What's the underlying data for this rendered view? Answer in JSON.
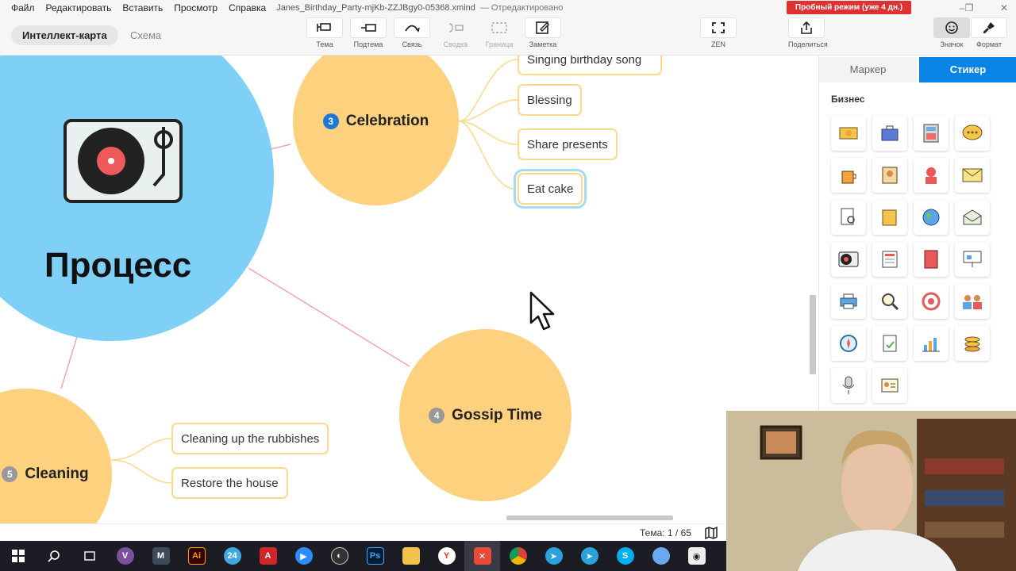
{
  "menu": {
    "items": [
      "Файл",
      "Редактировать",
      "Вставить",
      "Просмотр",
      "Справка"
    ],
    "document_title": "Janes_Birthday_Party-mjKb-ZZJBgy0-05368.xmind",
    "document_status": "— Отредактировано",
    "trial_badge": "Пробный режим (уже 4 дн.)"
  },
  "toolbar": {
    "view_tabs": [
      "Интеллект-карта",
      "Схема"
    ],
    "tools": {
      "topic": "Тема",
      "subtopic": "Подтема",
      "relationship": "Связь",
      "summary": "Сводка",
      "boundary": "Граница",
      "note": "Заметка",
      "zen": "ZEN",
      "share": "Поделиться",
      "icon": "Значок",
      "format": "Формат"
    }
  },
  "canvas": {
    "central_topic": "Процесс",
    "topics": [
      {
        "number": "3",
        "title": "Celebration",
        "color": "#fdd17d"
      },
      {
        "number": "4",
        "title": "Gossip Time",
        "color": "#fdd17d"
      },
      {
        "number": "5",
        "title": "Cleaning",
        "color": "#fdd17d"
      }
    ],
    "subtopics": {
      "celebration": [
        "Singing birthday song",
        "Blessing",
        "Share presents",
        "Eat cake"
      ],
      "cleaning": [
        "Cleaning up the rubbishes",
        "Restore  the house"
      ]
    },
    "central_color": "#7fd0f7",
    "link_color": "#f2a7b1",
    "branch_color": "#ffd98a",
    "selected_subtopic": "Eat cake"
  },
  "statusbar": {
    "sheet_indicator": "Тема: 1 / 65"
  },
  "right_panel": {
    "tabs": [
      "Маркер",
      "Стикер"
    ],
    "active_tab": "Стикер",
    "category": "Бизнес",
    "stickers": [
      "money-icon",
      "briefcase-icon",
      "calculator-icon",
      "chat-icon",
      "coffee-icon",
      "id-badge-icon",
      "support-agent-icon",
      "envelope-icon",
      "document-search-icon",
      "folder-icon",
      "globe-icon",
      "mail-open-icon",
      "record-player-icon",
      "newspaper-icon",
      "book-icon",
      "presentation-icon",
      "printer-icon",
      "magnifier-icon",
      "target-icon",
      "team-icon",
      "compass-icon",
      "checklist-icon",
      "bar-chart-icon",
      "coins-icon",
      "microphone-icon",
      "contact-card-icon"
    ]
  },
  "taskbar": {
    "apps": [
      "windows-start-icon",
      "search-icon",
      "task-view-icon",
      "viber-icon",
      "gmail-icon",
      "illustrator-icon",
      "calendar-24-icon",
      "acrobat-icon",
      "zoom-icon",
      "obs-icon",
      "photoshop-icon",
      "file-explorer-icon",
      "yandex-browser-icon",
      "xmind-icon",
      "chrome-icon",
      "telegram-icon",
      "telegram-2-icon",
      "skype-icon",
      "cloud-icon",
      "camera-icon"
    ],
    "active_app": "xmind-icon"
  }
}
